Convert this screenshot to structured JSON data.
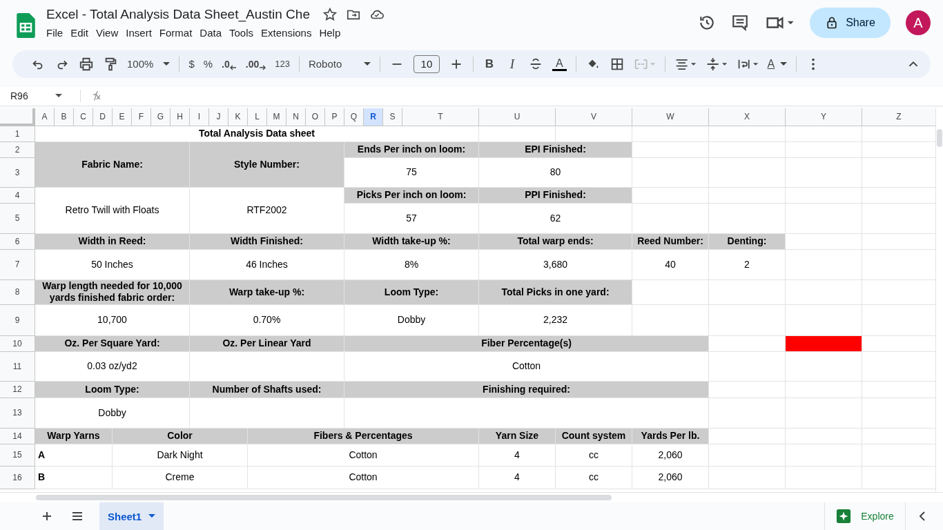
{
  "app": {
    "title": "Excel - Total Analysis Data Sheet_Austin Che",
    "menu": [
      "File",
      "Edit",
      "View",
      "Insert",
      "Format",
      "Data",
      "Tools",
      "Extensions",
      "Help"
    ],
    "share": "Share",
    "avatar": "A"
  },
  "toolbar": {
    "zoom": "100%",
    "currency": "$",
    "percent": "%",
    "decrease_decimal": ".0",
    "increase_decimal": ".00",
    "number_format": "123",
    "font": "Roboto",
    "font_size": "10",
    "bold": "B",
    "italic": "I",
    "text_color": "A",
    "text_direction": "A"
  },
  "formula_bar": {
    "cell_ref": "R96"
  },
  "sheet": {
    "columns": [
      {
        "label": "A",
        "selected": false
      },
      {
        "label": "B",
        "selected": false
      },
      {
        "label": "C",
        "selected": false
      },
      {
        "label": "D",
        "selected": false
      },
      {
        "label": "E",
        "selected": false
      },
      {
        "label": "F",
        "selected": false
      },
      {
        "label": "G",
        "selected": false
      },
      {
        "label": "H",
        "selected": false
      },
      {
        "label": "I",
        "selected": false
      },
      {
        "label": "J",
        "selected": false
      },
      {
        "label": "K",
        "selected": false
      },
      {
        "label": "L",
        "selected": false
      },
      {
        "label": "M",
        "selected": false
      },
      {
        "label": "N",
        "selected": false
      },
      {
        "label": "O",
        "selected": false
      },
      {
        "label": "P",
        "selected": false
      },
      {
        "label": "Q",
        "selected": false
      },
      {
        "label": "R",
        "selected": true
      },
      {
        "label": "S",
        "selected": false
      },
      {
        "label": "T",
        "selected": false
      },
      {
        "label": "U",
        "selected": false
      },
      {
        "label": "V",
        "selected": false
      },
      {
        "label": "W",
        "selected": false
      },
      {
        "label": "X",
        "selected": false
      },
      {
        "label": "Y",
        "selected": false
      },
      {
        "label": "Z",
        "selected": false
      }
    ],
    "rows": [
      {
        "number": "1",
        "kind": "form",
        "cells": [
          {
            "text": "Total Analysis Data sheet",
            "colspan": 20,
            "shaded": false,
            "bold": true
          },
          {
            "shaded": false
          },
          {
            "shaded": false
          },
          {
            "shaded": false
          },
          {
            "shaded": false
          },
          {
            "shaded": false
          },
          {
            "shaded": false
          }
        ]
      },
      {
        "number": "2",
        "kind": "form",
        "cells": [
          {
            "text": "Fabric Name:",
            "colspan": 8,
            "rowspan": 2,
            "shaded": true,
            "bold": true
          },
          {
            "text": "Style Number:",
            "colspan": 8,
            "rowspan": 2,
            "shaded": true,
            "bold": true
          },
          {
            "text": "Ends Per inch on loom:",
            "colspan": 4,
            "shaded": true,
            "bold": true
          },
          {
            "text": "EPI Finished:",
            "colspan": 2,
            "shaded": true,
            "bold": true
          },
          {
            "shaded": false
          },
          {
            "shaded": false
          },
          {
            "shaded": false
          },
          {
            "shaded": false
          }
        ]
      },
      {
        "number": "3",
        "kind": "form",
        "cells": [
          {
            "text": "75",
            "colspan": 4,
            "shaded": false,
            "bold": false
          },
          {
            "text": "80",
            "colspan": 2,
            "shaded": false,
            "bold": false
          },
          {
            "shaded": false
          },
          {
            "shaded": false
          },
          {
            "shaded": false
          },
          {
            "shaded": false
          }
        ]
      },
      {
        "number": "4",
        "kind": "form",
        "cells": [
          {
            "text": "Retro Twill with Floats",
            "colspan": 8,
            "rowspan": 2,
            "shaded": false,
            "bold": false
          },
          {
            "text": "RTF2002",
            "colspan": 8,
            "rowspan": 2,
            "shaded": false,
            "bold": false
          },
          {
            "text": "Picks Per inch on loom:",
            "colspan": 4,
            "shaded": true,
            "bold": true
          },
          {
            "text": "PPI Finished:",
            "colspan": 2,
            "shaded": true,
            "bold": true
          },
          {
            "shaded": false
          },
          {
            "shaded": false
          },
          {
            "shaded": false
          },
          {
            "shaded": false
          }
        ]
      },
      {
        "number": "5",
        "kind": "form",
        "cells": [
          {
            "text": "57",
            "colspan": 4,
            "shaded": false,
            "bold": false
          },
          {
            "text": "62",
            "colspan": 2,
            "shaded": false,
            "bold": false
          },
          {
            "shaded": false
          },
          {
            "shaded": false
          },
          {
            "shaded": false
          },
          {
            "shaded": false
          }
        ]
      },
      {
        "number": "6",
        "kind": "form",
        "cells": [
          {
            "text": "Width in Reed:",
            "colspan": 8,
            "shaded": true,
            "bold": true
          },
          {
            "text": "Width Finished:",
            "colspan": 8,
            "shaded": true,
            "bold": true
          },
          {
            "text": "Width take-up %:",
            "colspan": 4,
            "shaded": true,
            "bold": true
          },
          {
            "text": "Total warp ends:",
            "colspan": 2,
            "shaded": true,
            "bold": true
          },
          {
            "text": "Reed Number:",
            "shaded": true,
            "bold": true
          },
          {
            "text": "Denting:",
            "shaded": true,
            "bold": true
          },
          {
            "shaded": false
          },
          {
            "shaded": false
          }
        ]
      },
      {
        "number": "7",
        "kind": "form",
        "cells": [
          {
            "text": "50 Inches",
            "colspan": 8,
            "shaded": false,
            "bold": false
          },
          {
            "text": "46 Inches",
            "colspan": 8,
            "shaded": false,
            "bold": false
          },
          {
            "text": "8%",
            "colspan": 4,
            "shaded": false,
            "bold": false
          },
          {
            "text": "3,680",
            "colspan": 2,
            "shaded": false,
            "bold": false
          },
          {
            "text": "40",
            "shaded": false,
            "bold": false
          },
          {
            "text": "2",
            "shaded": false,
            "bold": false
          },
          {
            "shaded": false
          },
          {
            "shaded": false
          }
        ]
      },
      {
        "number": "8",
        "kind": "form",
        "cells": [
          {
            "text": "Warp length needed for 10,000 yards finished fabric order:",
            "colspan": 8,
            "shaded": true,
            "bold": true
          },
          {
            "text": "Warp take-up %:",
            "colspan": 8,
            "shaded": true,
            "bold": true
          },
          {
            "text": "Loom Type:",
            "colspan": 4,
            "shaded": true,
            "bold": true
          },
          {
            "text": "Total Picks in one yard:",
            "colspan": 2,
            "shaded": true,
            "bold": true
          },
          {
            "shaded": false
          },
          {
            "shaded": false
          },
          {
            "shaded": false
          },
          {
            "shaded": false
          }
        ]
      },
      {
        "number": "9",
        "kind": "form",
        "cells": [
          {
            "text": "10,700",
            "colspan": 8,
            "shaded": false,
            "bold": false
          },
          {
            "text": "0.70%",
            "colspan": 8,
            "shaded": false,
            "bold": false
          },
          {
            "text": "Dobby",
            "colspan": 4,
            "shaded": false,
            "bold": false
          },
          {
            "text": "2,232",
            "colspan": 2,
            "shaded": false,
            "bold": false
          },
          {
            "shaded": false
          },
          {
            "shaded": false
          },
          {
            "shaded": false
          },
          {
            "shaded": false
          }
        ]
      },
      {
        "number": "10",
        "kind": "form",
        "cells": [
          {
            "text": "Oz.  Per Square Yard:",
            "colspan": 8,
            "shaded": true,
            "bold": true
          },
          {
            "text": "Oz. Per Linear Yard",
            "colspan": 8,
            "shaded": true,
            "bold": true
          },
          {
            "text": "Fiber Percentage(s)",
            "colspan": 7,
            "shaded": true,
            "bold": true
          },
          {
            "shaded": false
          },
          {
            "color": "#ff0000"
          },
          {
            "shaded": false
          }
        ]
      },
      {
        "number": "11",
        "kind": "form",
        "cells": [
          {
            "text": "0.03 oz/yd2",
            "colspan": 8,
            "shaded": false,
            "bold": false
          },
          {
            "colspan": 8,
            "shaded": false
          },
          {
            "text": "Cotton",
            "colspan": 7,
            "shaded": false,
            "bold": false
          },
          {
            "shaded": false
          },
          {
            "shaded": false
          },
          {
            "shaded": false
          }
        ]
      },
      {
        "number": "12",
        "kind": "form",
        "cells": [
          {
            "text": "Loom Type:",
            "colspan": 8,
            "shaded": true,
            "bold": true
          },
          {
            "text": "Number of Shafts used:",
            "colspan": 8,
            "shaded": true,
            "bold": true
          },
          {
            "text": "Finishing required:",
            "colspan": 7,
            "shaded": true,
            "bold": true
          },
          {
            "shaded": false
          },
          {
            "shaded": false
          },
          {
            "shaded": false
          }
        ]
      },
      {
        "number": "13",
        "kind": "form",
        "cells": [
          {
            "text": "Dobby",
            "colspan": 8,
            "shaded": false,
            "bold": false
          },
          {
            "colspan": 8,
            "shaded": false
          },
          {
            "colspan": 7,
            "shaded": false
          },
          {
            "shaded": false
          },
          {
            "shaded": false
          },
          {
            "shaded": false
          }
        ]
      },
      {
        "number": "14",
        "kind": "form",
        "cells": [
          {
            "text": "Warp Yarns",
            "colspan": 4,
            "shaded": true,
            "bold": true
          },
          {
            "text": "Color",
            "colspan": 7,
            "shaded": true,
            "bold": true
          },
          {
            "text": "Fibers & Percentages",
            "colspan": 9,
            "shaded": true,
            "bold": true
          },
          {
            "text": "Yarn Size",
            "shaded": true,
            "bold": true
          },
          {
            "text": "Count system",
            "shaded": true,
            "bold": true
          },
          {
            "text": "Yards Per lb.",
            "shaded": true,
            "bold": true
          },
          {
            "shaded": false
          },
          {
            "shaded": false
          },
          {
            "shaded": false
          }
        ]
      },
      {
        "number": "15",
        "kind": "yarn",
        "cells": [
          {
            "text": "A",
            "colspan": 4,
            "shaded": false,
            "bold": true
          },
          {
            "text": "Dark Night",
            "colspan": 7,
            "shaded": false,
            "bold": false
          },
          {
            "text": "Cotton",
            "colspan": 9,
            "shaded": false,
            "bold": false
          },
          {
            "text": "4",
            "shaded": false,
            "bold": false
          },
          {
            "text": "cc",
            "shaded": false,
            "bold": false
          },
          {
            "text": "2,060",
            "shaded": false,
            "bold": false
          },
          {
            "shaded": false
          },
          {
            "shaded": false
          },
          {
            "shaded": false
          }
        ]
      },
      {
        "number": "16",
        "kind": "yarn",
        "cells": [
          {
            "text": "B",
            "colspan": 4,
            "shaded": false,
            "bold": true
          },
          {
            "text": "Creme",
            "colspan": 7,
            "shaded": false,
            "bold": false
          },
          {
            "text": "Cotton",
            "colspan": 9,
            "shaded": false,
            "bold": false
          },
          {
            "text": "4",
            "shaded": false,
            "bold": false
          },
          {
            "text": "cc",
            "shaded": false,
            "bold": false
          },
          {
            "text": "2,060",
            "shaded": false,
            "bold": false
          },
          {
            "shaded": false
          },
          {
            "shaded": false
          },
          {
            "shaded": false
          }
        ]
      }
    ]
  },
  "sheets": [
    {
      "name": "Sheet1",
      "selected": true
    }
  ],
  "explore": "Explore"
}
